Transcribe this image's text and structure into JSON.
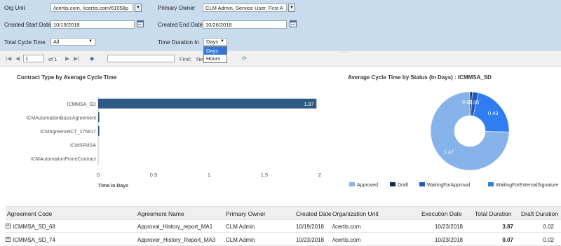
{
  "filters": {
    "org_unit_label": "Org Unit",
    "org_unit_value": "/icertis.com, /icertis.com/61058p",
    "primary_owner_label": "Primary Owner",
    "primary_owner_value": "CLM Admin, Service User, First A",
    "created_start_label": "Created Start Date",
    "created_start_value": "10/19/2018",
    "created_end_label": "Created End Date",
    "created_end_value": "10/26/2018",
    "total_cycle_label": "Total Cycle Time",
    "total_cycle_value": "All",
    "time_duration_label": "Time Duration In",
    "time_duration_value": "Days",
    "time_duration_options": [
      "Days",
      "Hours"
    ]
  },
  "toolbar": {
    "page_value": "1",
    "of_label": "of 1",
    "find_label": "Find",
    "next_label": "Ne"
  },
  "bar_chart_title": "Contract Type by Average Cycle Time",
  "pie_chart_title": "Average Cycle Time by Status (In Days) : ICMMSA_SD",
  "chart_data": [
    {
      "type": "bar",
      "orientation": "horizontal",
      "categories": [
        "ICMMSA_SD",
        "ICMAutomationBasicAgreement",
        "ICMAgreemetCT_275817",
        "ICMSFMSA",
        "ICMAutomationPrimeContract"
      ],
      "values": [
        1.97,
        0.01,
        0.01,
        0,
        0
      ],
      "data_labels": [
        "1.97"
      ],
      "xlabel": "Time in Days",
      "xticks": [
        "0",
        "0.5",
        "1",
        "1.5",
        "2"
      ],
      "xlim": [
        0,
        2
      ],
      "color": "#2f5a84"
    },
    {
      "type": "pie",
      "donut": true,
      "labels": [
        "Approved",
        "Draft",
        "WaitingForApproval",
        "WaitingForExternalSignature"
      ],
      "values": [
        1.47,
        0.02,
        0.05,
        0.43
      ],
      "data_labels": [
        "1.47",
        "0.02",
        "0.05",
        "0.43"
      ],
      "colors": [
        "#86b3ea",
        "#0f2a55",
        "#1c5cc2",
        "#2f7df0"
      ],
      "legend": "bottom"
    }
  ],
  "grid": {
    "columns": [
      "Agreement Code",
      "Agreement Name",
      "Primary Owner",
      "Created Date",
      "Organization Unit",
      "Execution Date",
      "Total Duration",
      "Draft Duration"
    ],
    "rows": [
      [
        "ICMMSA_SD_68",
        "Approval_History_report_MA1",
        "CLM Admin",
        "10/19/2018",
        "/icertis.com",
        "10/23/2018",
        "3.87",
        "0.02"
      ],
      [
        "ICMMSA_SD_74",
        "Approver_History_Report_MA3",
        "CLM Admin",
        "10/23/2018",
        "/icertis.com",
        "10/23/2018",
        "0.07",
        "0.02"
      ]
    ]
  }
}
